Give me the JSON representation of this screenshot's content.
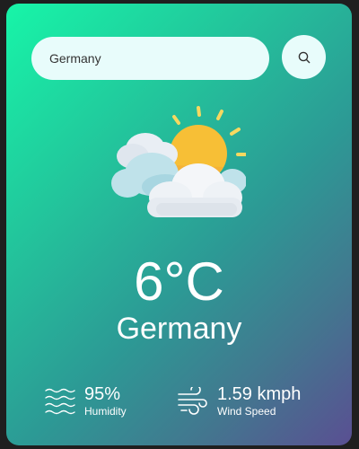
{
  "search": {
    "value": "Germany",
    "button_icon": "search-icon"
  },
  "weather": {
    "icon": "partly-cloudy-icon",
    "temperature": "6°C",
    "city": "Germany"
  },
  "details": {
    "humidity": {
      "icon": "humidity-waves-icon",
      "value": "95%",
      "label": "Humidity"
    },
    "wind": {
      "icon": "wind-icon",
      "value": "1.59 kmph",
      "label": "Wind Speed"
    }
  },
  "colors": {
    "gradient_start": "#17f5a8",
    "gradient_end": "#5a4f92",
    "input_background": "#e8fcfb",
    "text": "#ffffff"
  }
}
